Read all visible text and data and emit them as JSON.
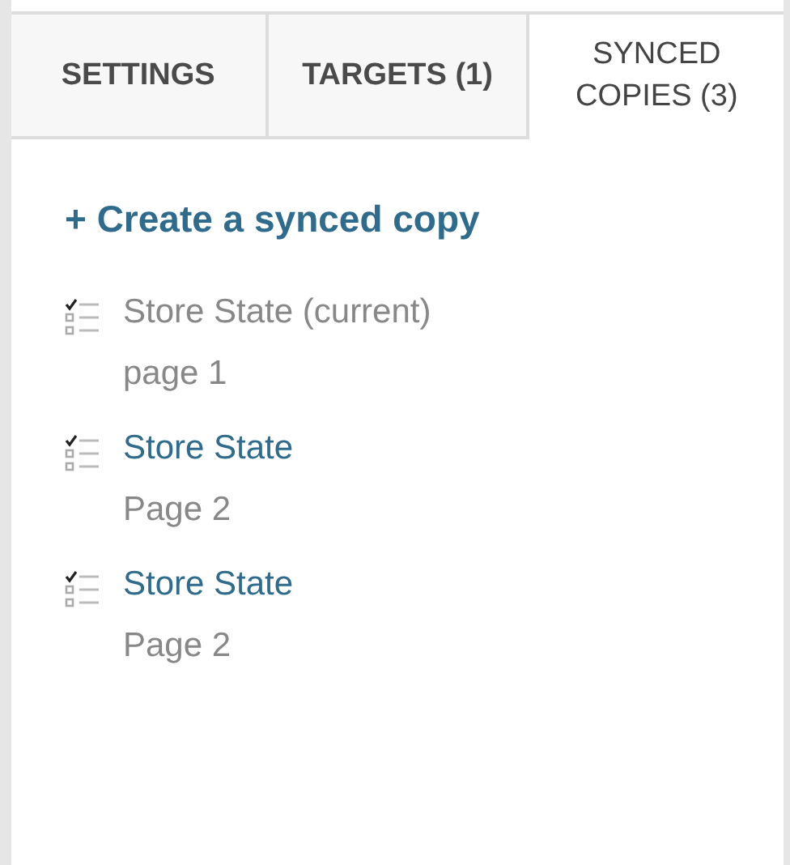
{
  "tabs": [
    {
      "label": "SETTINGS",
      "selected": false
    },
    {
      "label": "TARGETS (1)",
      "selected": false
    },
    {
      "label": "SYNCED COPIES (3)",
      "selected": true
    }
  ],
  "create_link": "+ Create a synced copy",
  "copies": [
    {
      "title": "Store State (current)",
      "page": "page 1",
      "current": true
    },
    {
      "title": "Store State",
      "page": "Page 2",
      "current": false
    },
    {
      "title": "Store State",
      "page": "Page 2",
      "current": false
    }
  ]
}
